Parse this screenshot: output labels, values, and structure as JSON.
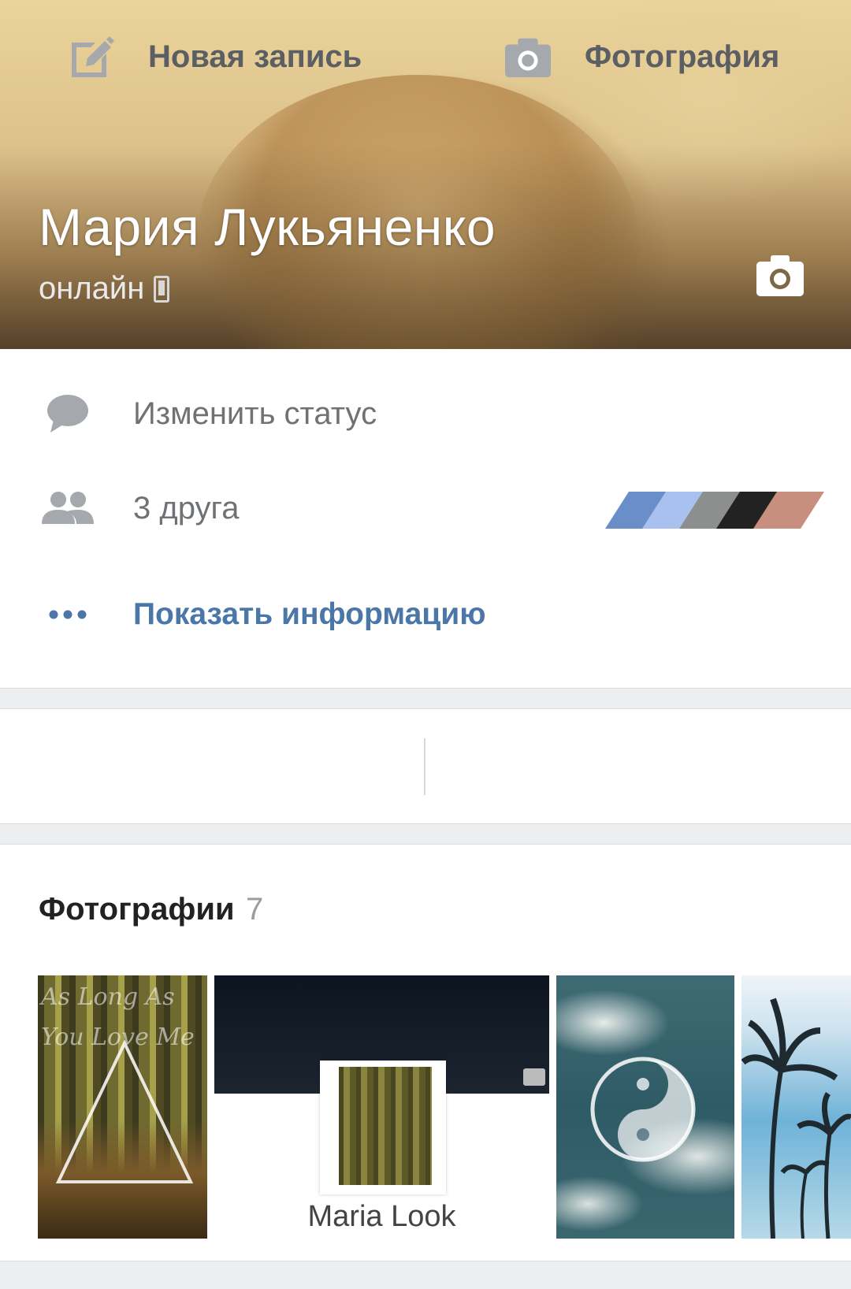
{
  "profile": {
    "name": "Мария Лукьяненко",
    "online_status": "онлайн"
  },
  "info": {
    "status_action": "Изменить статус",
    "friends": "3 друга",
    "show_info": "Показать информацию"
  },
  "friend_avatar_colors": [
    "#6a8fc8",
    "#a9c1ee",
    "#8d8f8e",
    "#222222",
    "#c98f7e"
  ],
  "actions": {
    "new_post": "Новая запись",
    "photo": "Фотография"
  },
  "photos": {
    "title": "Фотографии",
    "count": "7",
    "items": [
      {
        "overlay_text": "As Long As You Love Me"
      },
      {
        "caption": "Maria Look"
      },
      {},
      {}
    ]
  },
  "colors": {
    "link_blue": "#4a76a8",
    "icon_gray": "#a5a8ac",
    "background": "#edeef0"
  }
}
